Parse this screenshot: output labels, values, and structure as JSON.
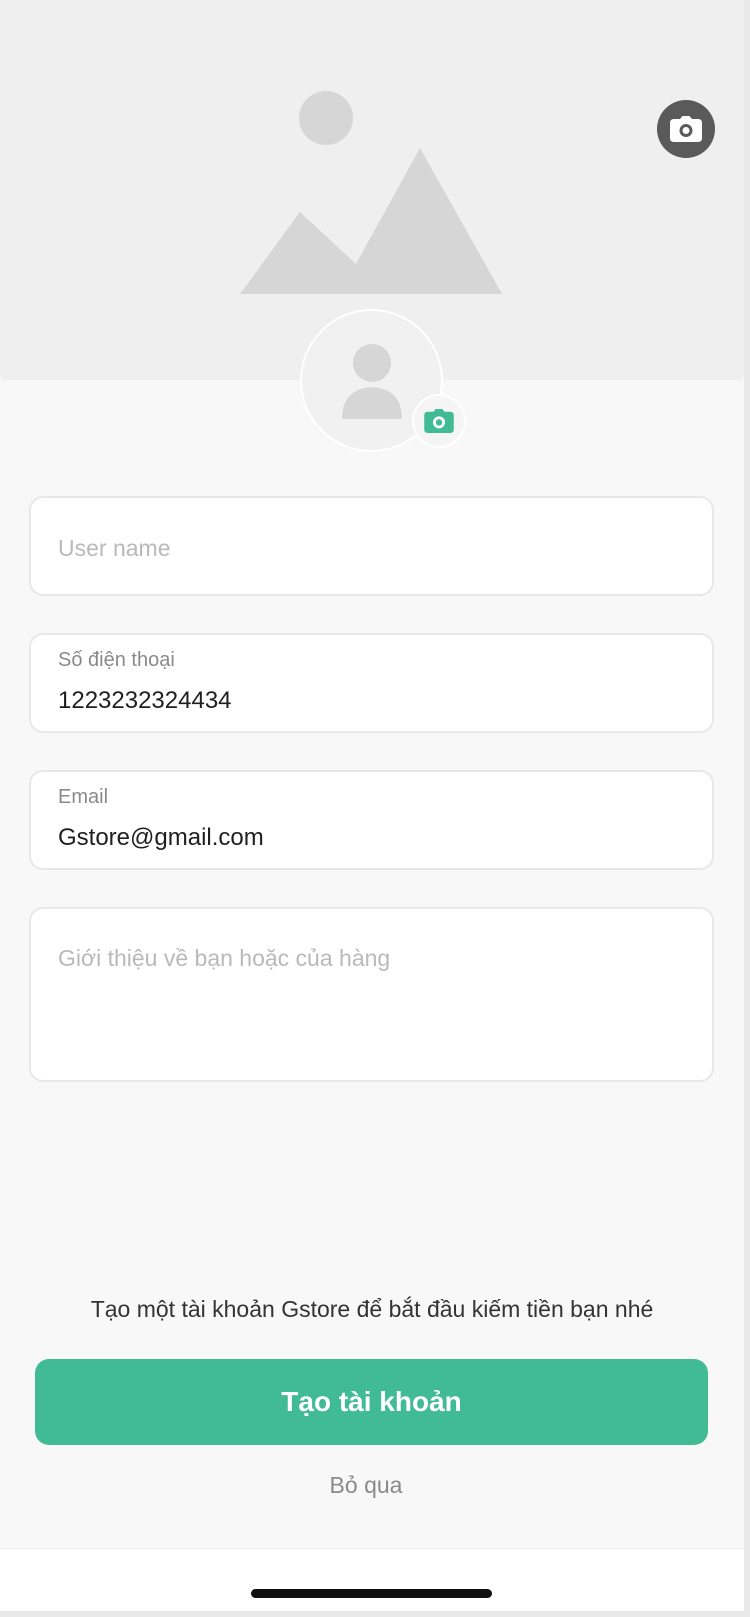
{
  "colors": {
    "accent": "#41bb93",
    "cover_bg": "#efefef",
    "page_bg": "#f8f8f8",
    "placeholder_graphic": "#d6d6d6",
    "dark_camera_btn": "#5a5a5a"
  },
  "cover": {
    "placeholder_icon": "image-placeholder-icon",
    "camera_icon": "camera-icon"
  },
  "avatar": {
    "placeholder_icon": "person-icon",
    "camera_icon": "camera-icon"
  },
  "form": {
    "username": {
      "placeholder": "User name",
      "value": ""
    },
    "phone": {
      "label": "Số điện thoại",
      "value": "1223232324434"
    },
    "email": {
      "label": "Email",
      "value": "Gstore@gmail.com"
    },
    "bio": {
      "placeholder": "Giới thiệu về bạn hoặc của hàng",
      "value": ""
    }
  },
  "footer": {
    "hint": "Tạo một tài khoản Gstore để bắt đầu kiếm tiền bạn nhé",
    "create_button_label": "Tạo tài khoản",
    "skip_label": "Bỏ qua"
  }
}
